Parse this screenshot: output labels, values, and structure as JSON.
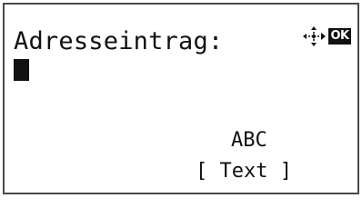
{
  "screen": {
    "prompt": "Adresseintrag:",
    "ok_label": "OK",
    "nav_icon": "navigation-arrows-icon",
    "input_mode": "ABC",
    "softkey_label": "[ Text ]"
  }
}
